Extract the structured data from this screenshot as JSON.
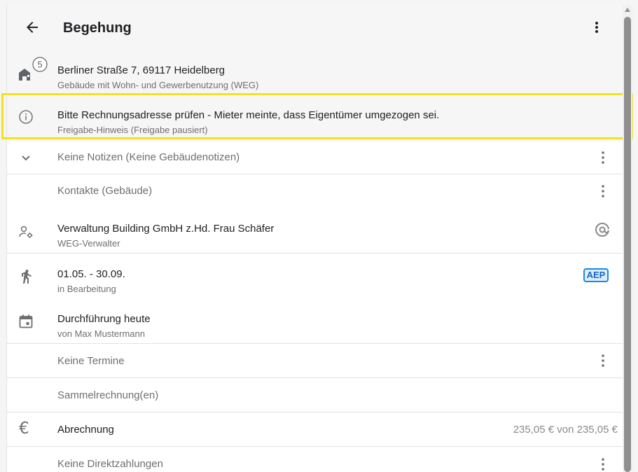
{
  "header": {
    "title": "Begehung"
  },
  "address": {
    "line1": "Berliner Straße 7, 69117 Heidelberg",
    "line2": "Gebäude mit Wohn- und Gewerbenutzung (WEG)",
    "badge_count": "5"
  },
  "notice": {
    "text": "Bitte Rechnungsadresse prüfen - Mieter meinte, dass Eigentümer umgezogen sei.",
    "sub": "Freigabe-Hinweis (Freigabe pausiert)"
  },
  "notes": {
    "label": "Keine Notizen (Keine Gebäudenotizen)"
  },
  "contacts": {
    "label": "Kontakte (Gebäude)"
  },
  "manager": {
    "name": "Verwaltung Building GmbH z.Hd. Frau Schäfer",
    "role": "WEG-Verwalter"
  },
  "period": {
    "range": "01.05. - 30.09.",
    "status": "in Bearbeitung",
    "badge": "AEP"
  },
  "execution": {
    "title": "Durchführung heute",
    "by": "von Max Mustermann"
  },
  "appointments": {
    "label": "Keine Termine"
  },
  "collective": {
    "label": "Sammelrechnung(en)"
  },
  "billing": {
    "label": "Abrechnung",
    "amount": "235,05 € von 235,05 €"
  },
  "direct": {
    "label": "Keine Direktzahlungen"
  },
  "icons": [
    "arrow-left-icon",
    "more-vert-icon",
    "building-icon",
    "info-icon",
    "chevron-down-icon",
    "manager-settings-icon",
    "at-icon",
    "walking-icon",
    "calendar-icon",
    "euro-icon"
  ],
  "colors": {
    "highlight": "#f5e31a",
    "badge_border": "#1e88e5",
    "badge_bg": "#dbeeff"
  }
}
